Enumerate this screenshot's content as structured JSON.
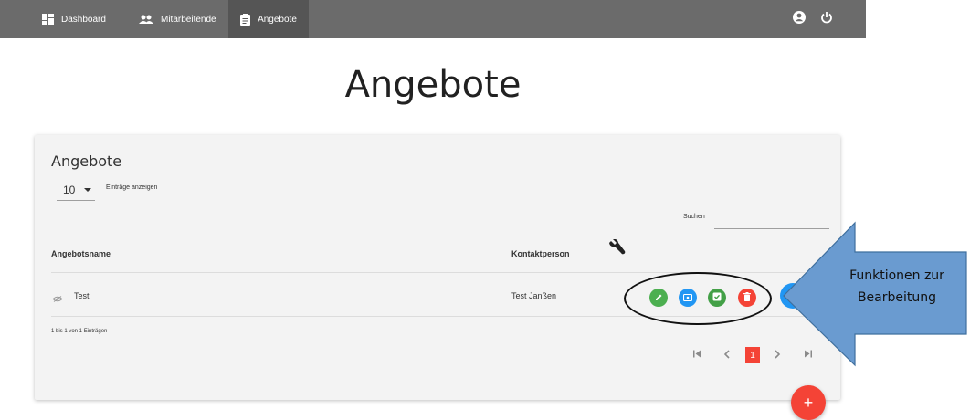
{
  "nav": {
    "items": [
      {
        "label": "Dashboard",
        "icon": "dashboard-icon"
      },
      {
        "label": "Mitarbeitende",
        "icon": "people-icon"
      },
      {
        "label": "Angebote",
        "icon": "clipboard-icon",
        "active": true
      }
    ],
    "right_icons": [
      "account-icon",
      "power-icon"
    ]
  },
  "page": {
    "title": "Angebote"
  },
  "card": {
    "title": "Angebote",
    "entries_select": "10",
    "entries_label": "Einträge anzeigen",
    "search_label": "Suchen",
    "search_value": ""
  },
  "table": {
    "headers": {
      "name": "Angebotsname",
      "contact": "Kontaktperson",
      "tools_icon": "wrench-icon"
    },
    "rows": [
      {
        "icon": "hidden-eye-icon",
        "name": "Test",
        "contact": "Test Janßen",
        "actions": [
          "edit-icon",
          "view-icon",
          "check-icon",
          "delete-icon"
        ]
      }
    ],
    "info": "1 bis 1 von 1 Einträgen"
  },
  "pagination": {
    "current": "1"
  },
  "fab": {
    "label": "+"
  },
  "annotation": {
    "line1": "Funktionen zur",
    "line2": "Bearbeitung"
  },
  "colors": {
    "navbar": "#6b6b6b",
    "accent_red": "#f44336",
    "edit_green": "#4caf50",
    "view_blue": "#2196f3",
    "check_green": "#43a047",
    "delete_red": "#f44336",
    "callout_fill": "#6a9bd0"
  }
}
